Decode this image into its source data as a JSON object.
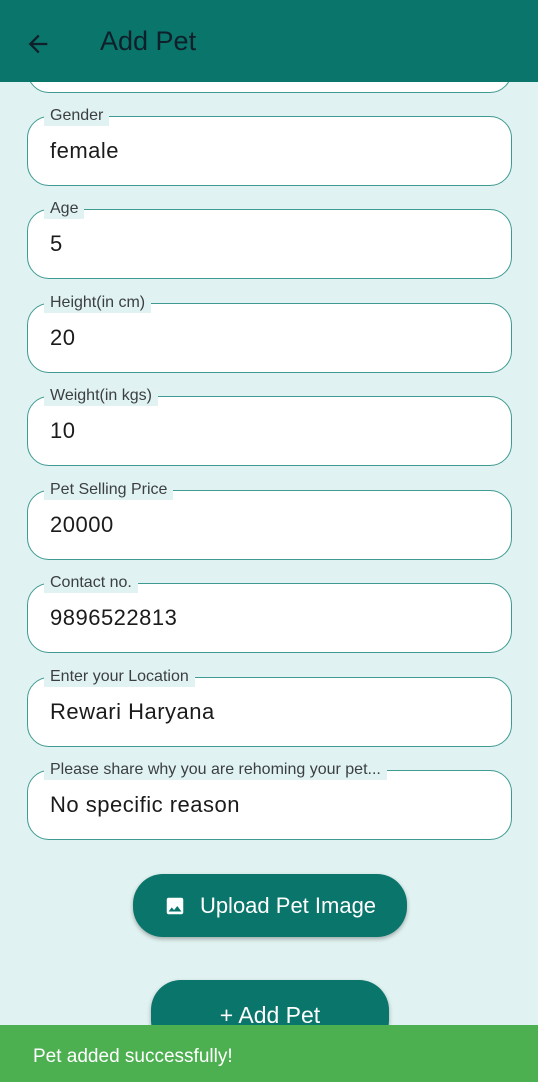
{
  "appbar": {
    "title": "Add Pet",
    "back_icon": "arrow-left-icon",
    "color": "#09756b"
  },
  "fields": [
    {
      "label": "Gender",
      "value": "female"
    },
    {
      "label": "Age",
      "value": "5"
    },
    {
      "label": "Height(in cm)",
      "value": "20"
    },
    {
      "label": "Weight(in kgs)",
      "value": "10"
    },
    {
      "label": "Pet Selling Price",
      "value": "20000"
    },
    {
      "label": "Contact no.",
      "value": "9896522813"
    },
    {
      "label": "Enter your Location",
      "value": "Rewari Haryana"
    },
    {
      "label": "Please share why you are rehoming your pet...",
      "value": "No specific reason"
    }
  ],
  "upload": {
    "label": "Upload Pet Image",
    "icon": "image-icon"
  },
  "add": {
    "label": "+ Add Pet"
  },
  "snackbar": {
    "text": "Pet added successfully!",
    "color": "#4caf50"
  }
}
